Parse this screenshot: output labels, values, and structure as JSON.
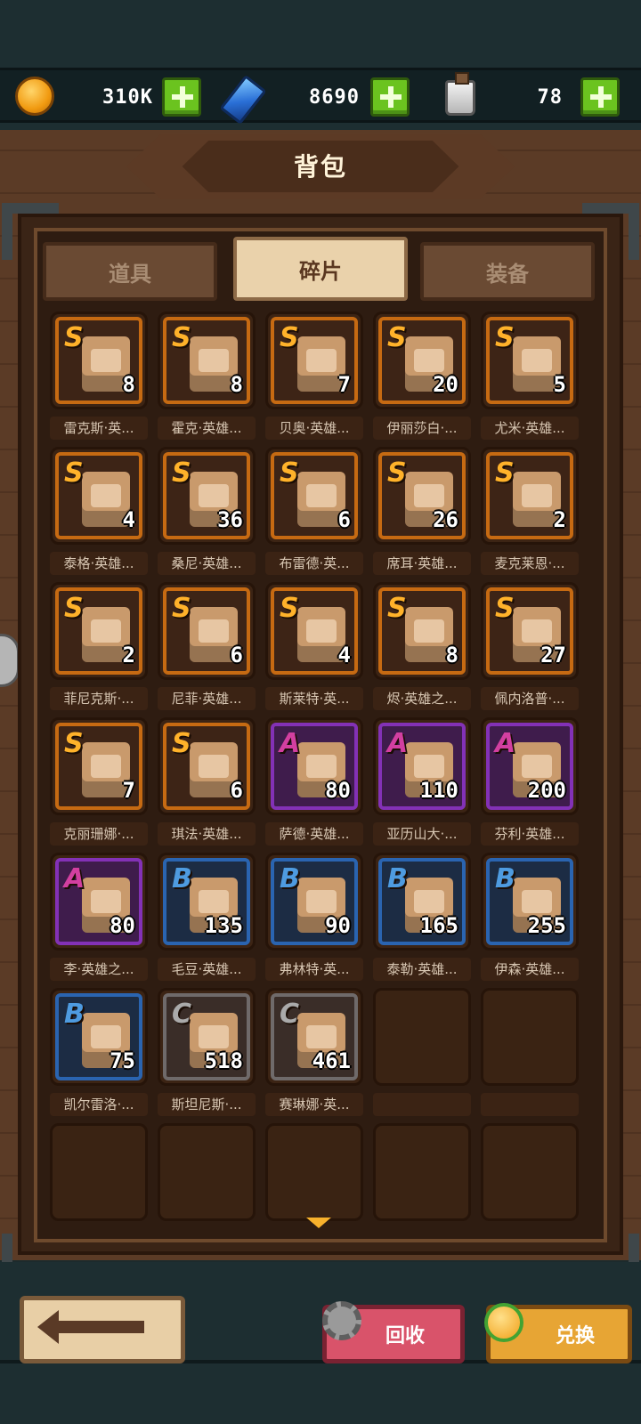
{
  "currencies": {
    "gold": {
      "value": "310K",
      "icon": "gold-coin-icon"
    },
    "gems": {
      "value": "8690",
      "icon": "blue-gem-icon"
    },
    "potion": {
      "value": "78",
      "icon": "potion-bottle-icon"
    }
  },
  "title": "背包",
  "tabs": [
    {
      "label": "道具",
      "active": false
    },
    {
      "label": "碎片",
      "active": true
    },
    {
      "label": "装备",
      "active": false
    }
  ],
  "items": [
    {
      "rank": "S",
      "count": "8",
      "name": "雷克斯·英..."
    },
    {
      "rank": "S",
      "count": "8",
      "name": "霍克·英雄..."
    },
    {
      "rank": "S",
      "count": "7",
      "name": "贝奥·英雄..."
    },
    {
      "rank": "S",
      "count": "20",
      "name": "伊丽莎白·..."
    },
    {
      "rank": "S",
      "count": "5",
      "name": "尤米·英雄..."
    },
    {
      "rank": "S",
      "count": "4",
      "name": "泰格·英雄..."
    },
    {
      "rank": "S",
      "count": "36",
      "name": "桑尼·英雄..."
    },
    {
      "rank": "S",
      "count": "6",
      "name": "布雷德·英..."
    },
    {
      "rank": "S",
      "count": "26",
      "name": "席耳·英雄..."
    },
    {
      "rank": "S",
      "count": "2",
      "name": "麦克莱恩·..."
    },
    {
      "rank": "S",
      "count": "2",
      "name": "菲尼克斯·..."
    },
    {
      "rank": "S",
      "count": "6",
      "name": "尼菲·英雄..."
    },
    {
      "rank": "S",
      "count": "4",
      "name": "斯莱特·英..."
    },
    {
      "rank": "S",
      "count": "8",
      "name": "烬·英雄之..."
    },
    {
      "rank": "S",
      "count": "27",
      "name": "佩内洛普·..."
    },
    {
      "rank": "S",
      "count": "7",
      "name": "克丽珊娜·..."
    },
    {
      "rank": "S",
      "count": "6",
      "name": "琪法·英雄..."
    },
    {
      "rank": "A",
      "count": "80",
      "name": "萨德·英雄..."
    },
    {
      "rank": "A",
      "count": "110",
      "name": "亚历山大·..."
    },
    {
      "rank": "A",
      "count": "200",
      "name": "芬利·英雄..."
    },
    {
      "rank": "A",
      "count": "80",
      "name": "李·英雄之..."
    },
    {
      "rank": "B",
      "count": "135",
      "name": "毛豆·英雄..."
    },
    {
      "rank": "B",
      "count": "90",
      "name": "弗林特·英..."
    },
    {
      "rank": "B",
      "count": "165",
      "name": "泰勒·英雄..."
    },
    {
      "rank": "B",
      "count": "255",
      "name": "伊森·英雄..."
    },
    {
      "rank": "B",
      "count": "75",
      "name": "凯尔雷洛·..."
    },
    {
      "rank": "C",
      "count": "518",
      "name": "斯坦尼斯·..."
    },
    {
      "rank": "C",
      "count": "461",
      "name": "赛琳娜·英..."
    }
  ],
  "footer": {
    "back_icon": "back-arrow-icon",
    "recycle_label": "回收",
    "exchange_label": "兑换"
  },
  "colors": {
    "rank_S": "#c66a12",
    "rank_A": "#8331b6",
    "rank_B": "#2a64b0",
    "rank_C": "#6f6a6a",
    "plus_button": "#6bc31f",
    "recycle_button": "#d9536a",
    "exchange_button": "#e7a534"
  }
}
